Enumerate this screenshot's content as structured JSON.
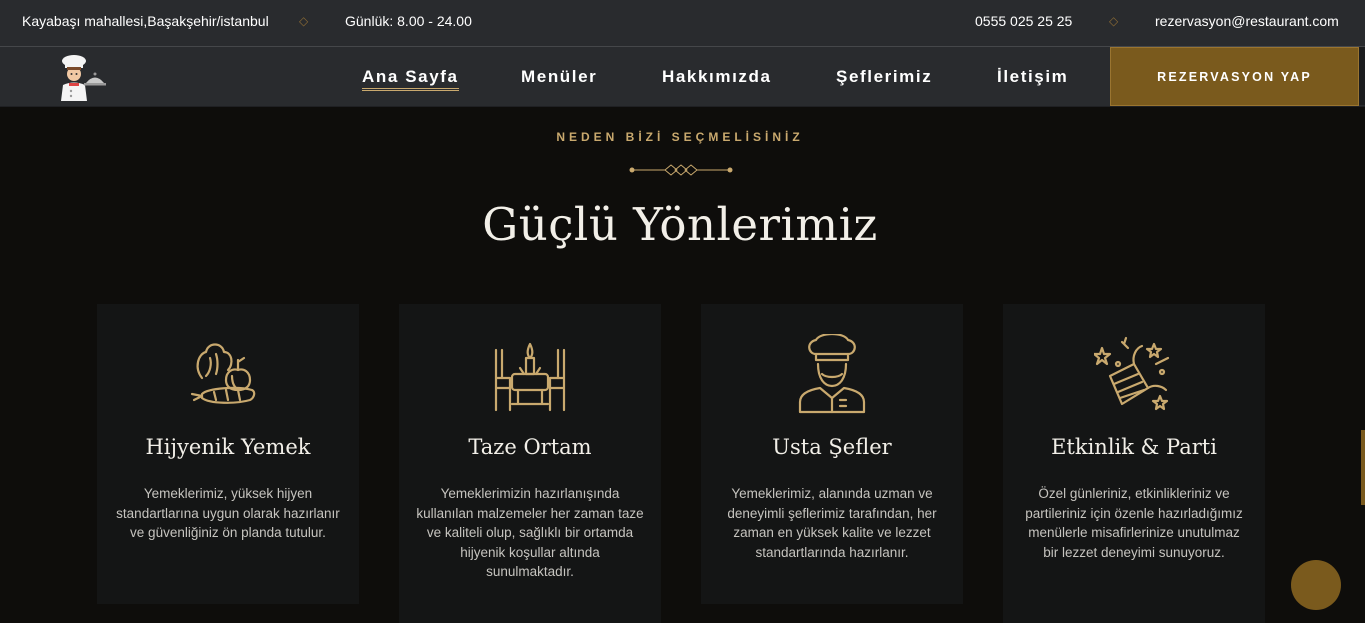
{
  "topbar": {
    "address": "Kayabaşı mahallesi,Başakşehir/istanbul",
    "hours": "Günlük: 8.00 - 24.00",
    "phone": "0555 025 25 25",
    "email": "rezervasyon@restaurant.com",
    "separator": "◇"
  },
  "nav": {
    "items": [
      {
        "label": "Ana Sayfa"
      },
      {
        "label": "Menüler"
      },
      {
        "label": "Hakkımızda"
      },
      {
        "label": "Şeflerimiz"
      },
      {
        "label": "İletişim"
      }
    ],
    "reserve_label": "REZERVASYON YAP"
  },
  "section": {
    "eyebrow": "NEDEN BİZİ SEÇMELİSİNİZ",
    "title": "Güçlü Yönlerimiz"
  },
  "cards": [
    {
      "icon": "vegetables-icon",
      "title": "Hijyenik Yemek",
      "description": "Yemeklerimiz, yüksek hijyen standartlarına uygun olarak hazırlanır ve güvenliğiniz ön planda tutulur."
    },
    {
      "icon": "dining-table-icon",
      "title": "Taze Ortam",
      "description": "Yemeklerimizin hazırlanışında kullanılan malzemeler her zaman taze ve kaliteli olup, sağlıklı bir ortamda hijyenik koşullar altında sunulmaktadır."
    },
    {
      "icon": "chef-icon",
      "title": "Usta Şefler",
      "description": "Yemeklerimiz, alanında uzman ve deneyimli şeflerimiz tarafından, her zaman en yüksek kalite ve lezzet standartlarında hazırlanır."
    },
    {
      "icon": "party-popper-icon",
      "title": "Etkinlik & Parti",
      "description": "Özel günleriniz, etkinlikleriniz ve partileriniz için özenle hazırladığımız menülerle misafirlerinize unutulmaz bir lezzet deneyimi sunuyoruz."
    }
  ],
  "colors": {
    "accent": "#c9a96e",
    "button": "#7a5a1d",
    "bar": "#292b2e",
    "background": "#0e0d0b",
    "card": "#141515"
  }
}
